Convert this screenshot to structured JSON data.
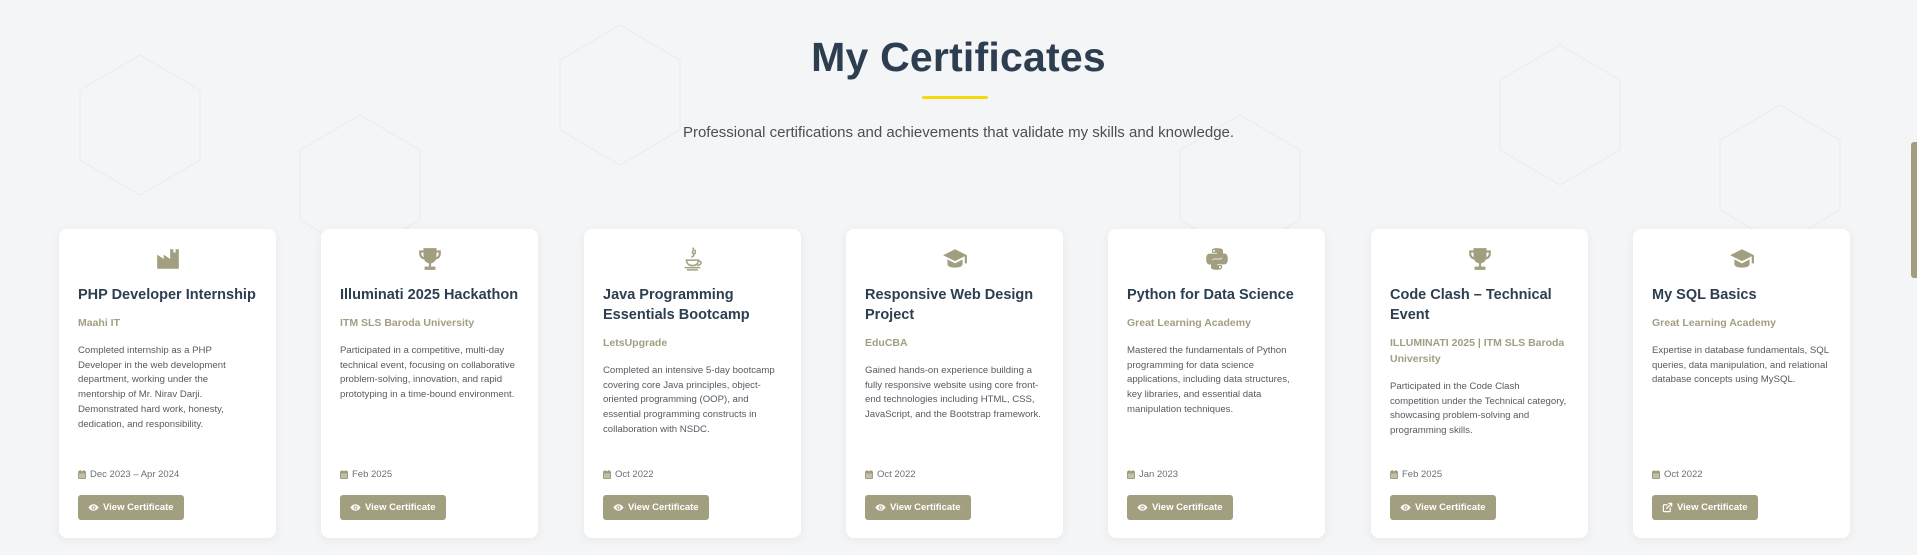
{
  "section": {
    "title": "My Certificates",
    "subtitle": "Professional certifications and achievements that validate my skills and knowledge."
  },
  "colors": {
    "accent": "#a29e80",
    "title": "#2c3e50",
    "underline": "#f5d90a",
    "background": "#f4f5f7"
  },
  "cards": [
    {
      "icon": "industry-icon",
      "title": "PHP Developer Internship",
      "issuer": "Maahi IT",
      "description": "Completed internship as a PHP Developer in the web development department, working under the mentorship of Mr. Nirav Darji. Demonstrated hard work, honesty, dedication, and responsibility.",
      "date": "Dec 2023 – Apr 2024",
      "button_label": "View Certificate",
      "button_icon": "eye-icon"
    },
    {
      "icon": "trophy-icon",
      "title": "Illuminati 2025 Hackathon",
      "issuer": "ITM SLS Baroda University",
      "description": "Participated in a competitive, multi-day technical event, focusing on collaborative problem-solving, innovation, and rapid prototyping in a time-bound environment.",
      "date": "Feb 2025",
      "button_label": "View Certificate",
      "button_icon": "eye-icon"
    },
    {
      "icon": "java-icon",
      "title": "Java Programming Essentials Bootcamp",
      "issuer": "LetsUpgrade",
      "description": "Completed an intensive 5-day bootcamp covering core Java principles, object-oriented programming (OOP), and essential programming constructs in collaboration with NSDC.",
      "date": "Oct 2022",
      "button_label": "View Certificate",
      "button_icon": "eye-icon"
    },
    {
      "icon": "graduation-cap-icon",
      "title": "Responsive Web Design Project",
      "issuer": "EduCBA",
      "description": "Gained hands-on experience building a fully responsive website using core front-end technologies including HTML, CSS, JavaScript, and the Bootstrap framework.",
      "date": "Oct 2022",
      "button_label": "View Certificate",
      "button_icon": "eye-icon"
    },
    {
      "icon": "python-icon",
      "title": "Python for Data Science",
      "issuer": "Great Learning Academy",
      "description": "Mastered the fundamentals of Python programming for data science applications, including data structures, key libraries, and essential data manipulation techniques.",
      "date": "Jan 2023",
      "button_label": "View Certificate",
      "button_icon": "eye-icon"
    },
    {
      "icon": "trophy-icon",
      "title": "Code Clash – Technical Event",
      "issuer": "ILLUMINATI 2025 | ITM SLS Baroda University",
      "description": "Participated in the Code Clash competition under the Technical category, showcasing problem-solving and programming skills.",
      "date": "Feb 2025",
      "button_label": "View Certificate",
      "button_icon": "eye-icon"
    },
    {
      "icon": "graduation-cap-icon",
      "title": "My SQL Basics",
      "issuer": "Great Learning Academy",
      "description": "Expertise in database fundamentals, SQL queries, data manipulation, and relational database concepts using MySQL.",
      "date": "Oct 2022",
      "button_label": "View Certificate",
      "button_icon": "external-link-icon"
    }
  ]
}
